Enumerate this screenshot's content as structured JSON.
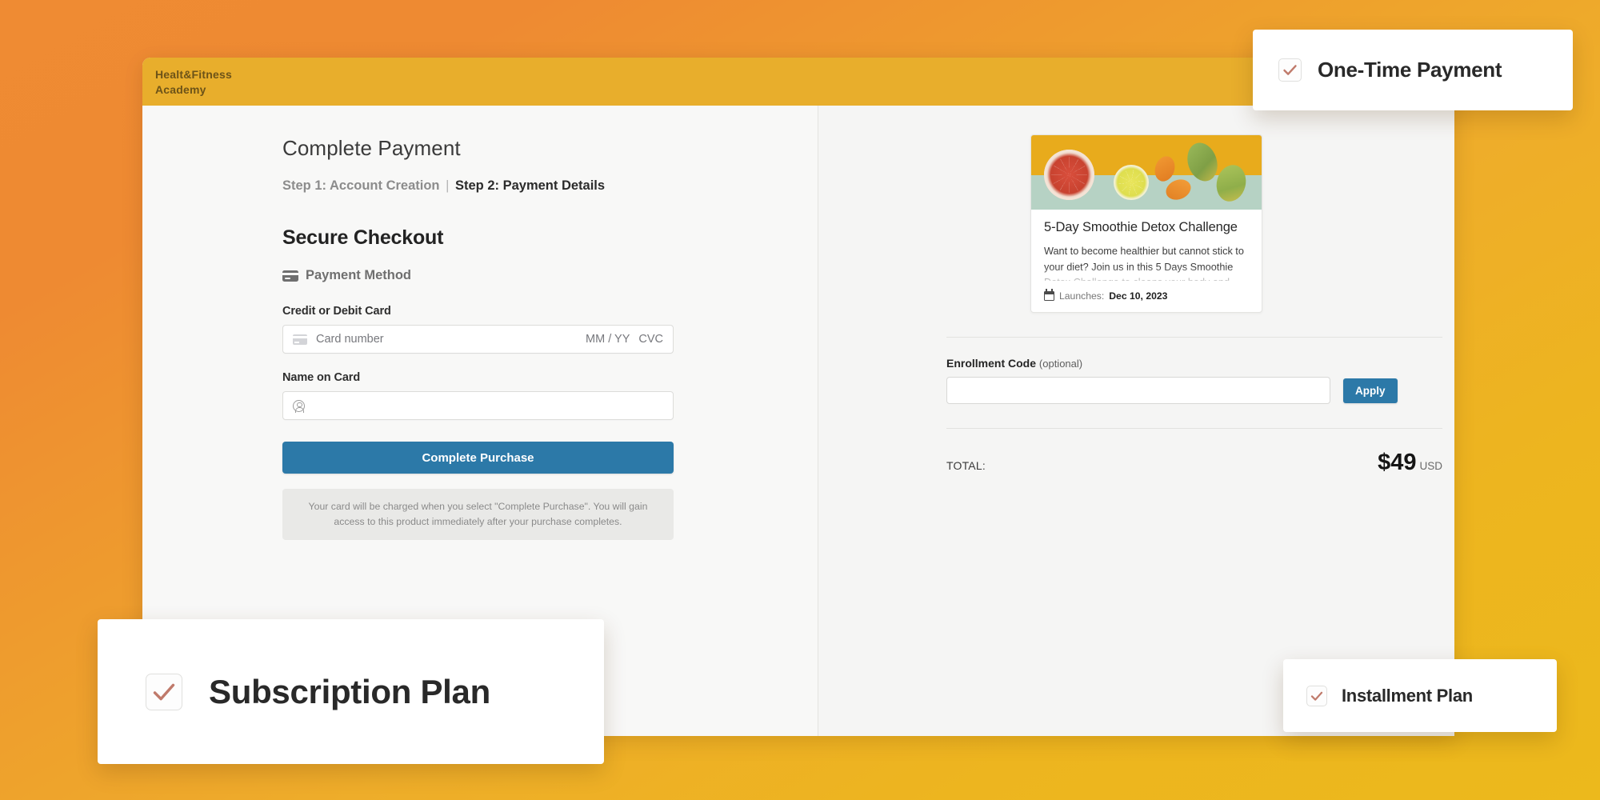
{
  "brand": {
    "name": "Healt&Fitness\nAcademy"
  },
  "checkout": {
    "page_title": "Complete Payment",
    "steps": {
      "step1": "Step 1: Account Creation",
      "separator": "|",
      "step2": "Step 2: Payment Details"
    },
    "secure_checkout_title": "Secure Checkout",
    "payment_method_label": "Payment Method",
    "card_label": "Credit or Debit Card",
    "card_number_placeholder": "Card number",
    "card_expiry_placeholder": "MM / YY",
    "card_cvc_placeholder": "CVC",
    "name_label": "Name on Card",
    "name_value": "",
    "submit_label": "Complete Purchase",
    "disclaimer": "Your card will be charged when you select \"Complete Purchase\". You will gain access to this product immediately after your purchase completes."
  },
  "summary": {
    "product": {
      "title": "5-Day Smoothie Detox Challenge",
      "description": "Want to become healthier but cannot stick to your diet? Join us in this 5 Days Smoothie Detox Challenge to cleans your body and reenergiz...",
      "launch_label": "Launches:",
      "launch_date": "Dec 10, 2023"
    },
    "enrollment": {
      "label": "Enrollment Code",
      "optional": "(optional)",
      "value": "",
      "placeholder": "",
      "apply_label": "Apply"
    },
    "total": {
      "label": "TOTAL:",
      "amount": "$49",
      "currency": "USD"
    }
  },
  "options": [
    {
      "label": "One-Time Payment",
      "checked": true
    },
    {
      "label": "Subscription Plan",
      "checked": true
    },
    {
      "label": "Installment Plan",
      "checked": true
    }
  ],
  "colors": {
    "page_background_start": "#ef8b33",
    "page_background_end": "#ecb91c",
    "header_bar": "#e8ae2c",
    "primary_button": "#2c79a8",
    "checkmark": "#c07a6b"
  }
}
